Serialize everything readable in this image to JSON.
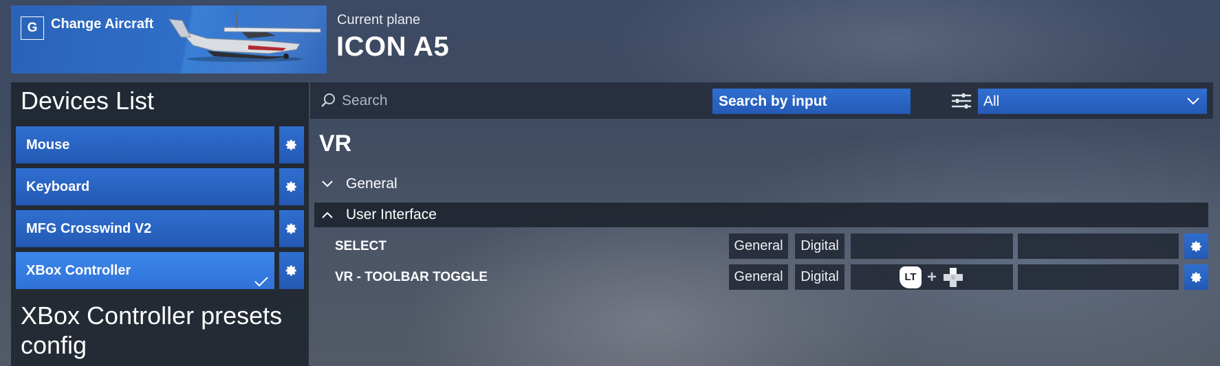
{
  "header": {
    "change_aircraft": {
      "key": "G",
      "label": "Change Aircraft"
    },
    "current_plane_caption": "Current plane",
    "plane_name": "ICON A5"
  },
  "left_panel": {
    "title": "Devices List",
    "devices": [
      {
        "label": "Mouse",
        "selected": false
      },
      {
        "label": "Keyboard",
        "selected": false
      },
      {
        "label": "MFG Crosswind V2",
        "selected": false
      },
      {
        "label": "XBox Controller",
        "selected": true
      }
    ],
    "preset_title": "XBox Controller presets config"
  },
  "search_bar": {
    "placeholder": "Search",
    "search_by_input_label": "Search by input",
    "filter_value": "All"
  },
  "main": {
    "section_title": "VR",
    "categories": [
      {
        "label": "General",
        "expanded": false
      },
      {
        "label": "User Interface",
        "expanded": true
      }
    ],
    "bindings": [
      {
        "action": "SELECT",
        "context": "General",
        "type": "Digital",
        "input1": "",
        "input2": ""
      },
      {
        "action": "VR - TOOLBAR TOGGLE",
        "context": "General",
        "type": "Digital",
        "input1_combo": [
          "LT",
          "+",
          "D-pad"
        ],
        "input2": ""
      }
    ]
  },
  "colors": {
    "accent_blue": "#2f6fd0",
    "selected_blue": "#3d86ea",
    "panel_dark": "#1e242e"
  }
}
